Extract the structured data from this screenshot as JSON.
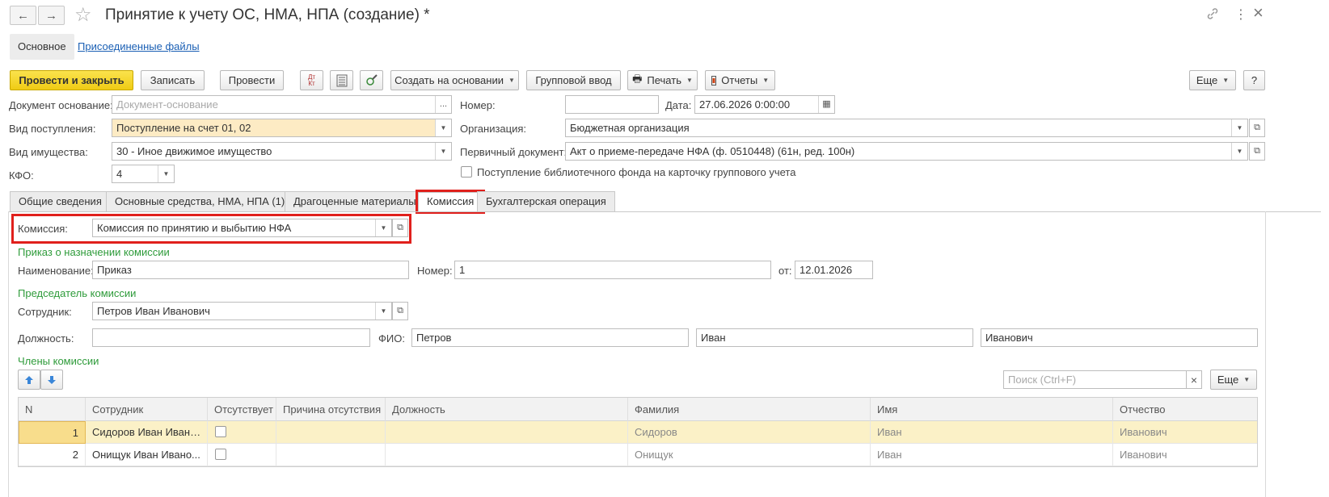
{
  "window": {
    "title": "Принятие к учету ОС, НМА, НПА (создание) *",
    "back_icon": "←",
    "forward_icon": "→",
    "star_icon": "☆",
    "link_icon": "🔗",
    "more_icon": "⋮",
    "close_icon": "×"
  },
  "section_tabs": {
    "main": "Основное",
    "files": "Присоединенные файлы"
  },
  "toolbar": {
    "post_close": "Провести и закрыть",
    "save": "Записать",
    "post": "Провести",
    "create_based": "Создать на основании",
    "group_input": "Групповой ввод",
    "print": "Печать",
    "reports": "Отчеты",
    "more": "Еще",
    "help": "?"
  },
  "header_fields": {
    "base_doc_label": "Документ основание:",
    "base_doc_placeholder": "Документ-основание",
    "receipt_type_label": "Вид поступления:",
    "receipt_type_value": "Поступление на счет 01, 02",
    "property_type_label": "Вид имущества:",
    "property_type_value": "30 - Иное движимое имущество",
    "kfo_label": "КФО:",
    "kfo_value": "4",
    "number_label": "Номер:",
    "number_value": "",
    "date_label": "Дата:",
    "date_value": "27.06.2026  0:00:00",
    "org_label": "Организация:",
    "org_value": "Бюджетная организация",
    "primary_doc_label": "Первичный документ:",
    "primary_doc_value": "Акт о приеме-передаче НФА (ф. 0510448) (61н, ред. 100н)",
    "library_checkbox_label": "Поступление библиотечного фонда на карточку группового учета"
  },
  "tabs": [
    {
      "label": "Общие сведения"
    },
    {
      "label": "Основные средства, НМА, НПА (1)"
    },
    {
      "label": "Драгоценные материалы"
    },
    {
      "label": "Комиссия"
    },
    {
      "label": "Бухгалтерская операция"
    }
  ],
  "commission": {
    "label": "Комиссия:",
    "value": "Комиссия по принятию и выбытию НФА",
    "order_heading": "Приказ о назначении комиссии",
    "order_name_label": "Наименование:",
    "order_name_value": "Приказ",
    "order_number_label": "Номер:",
    "order_number_value": "1",
    "order_date_label": "от:",
    "order_date_value": "12.01.2026",
    "chair_heading": "Председатель комиссии",
    "employee_label": "Сотрудник:",
    "employee_value": "Петров Иван Иванович",
    "position_label": "Должность:",
    "position_value": "",
    "fio_label": "ФИО:",
    "last_name": "Петров",
    "first_name": "Иван",
    "patronymic": "Иванович",
    "members_heading": "Члены комиссии",
    "search_placeholder": "Поиск (Ctrl+F)",
    "more": "Еще"
  },
  "members_table": {
    "columns": [
      "N",
      "Сотрудник",
      "Отсутствует",
      "Причина отсутствия",
      "Должность",
      "Фамилия",
      "Имя",
      "Отчество"
    ],
    "rows": [
      {
        "n": "1",
        "employee": "Сидоров Иван Ивано...",
        "absent": false,
        "reason": "",
        "position": "",
        "last": "Сидоров",
        "first": "Иван",
        "patronymic": "Иванович"
      },
      {
        "n": "2",
        "employee": "Онищук Иван Ивано...",
        "absent": false,
        "reason": "",
        "position": "",
        "last": "Онищук",
        "first": "Иван",
        "patronymic": "Иванович"
      }
    ]
  },
  "colors": {
    "accent_yellow": "#f6d32d",
    "highlight_red": "#e0201c",
    "green_heading": "#2e9b3a",
    "link_blue": "#1a5fb4",
    "selected_row": "#fbf1c7"
  }
}
